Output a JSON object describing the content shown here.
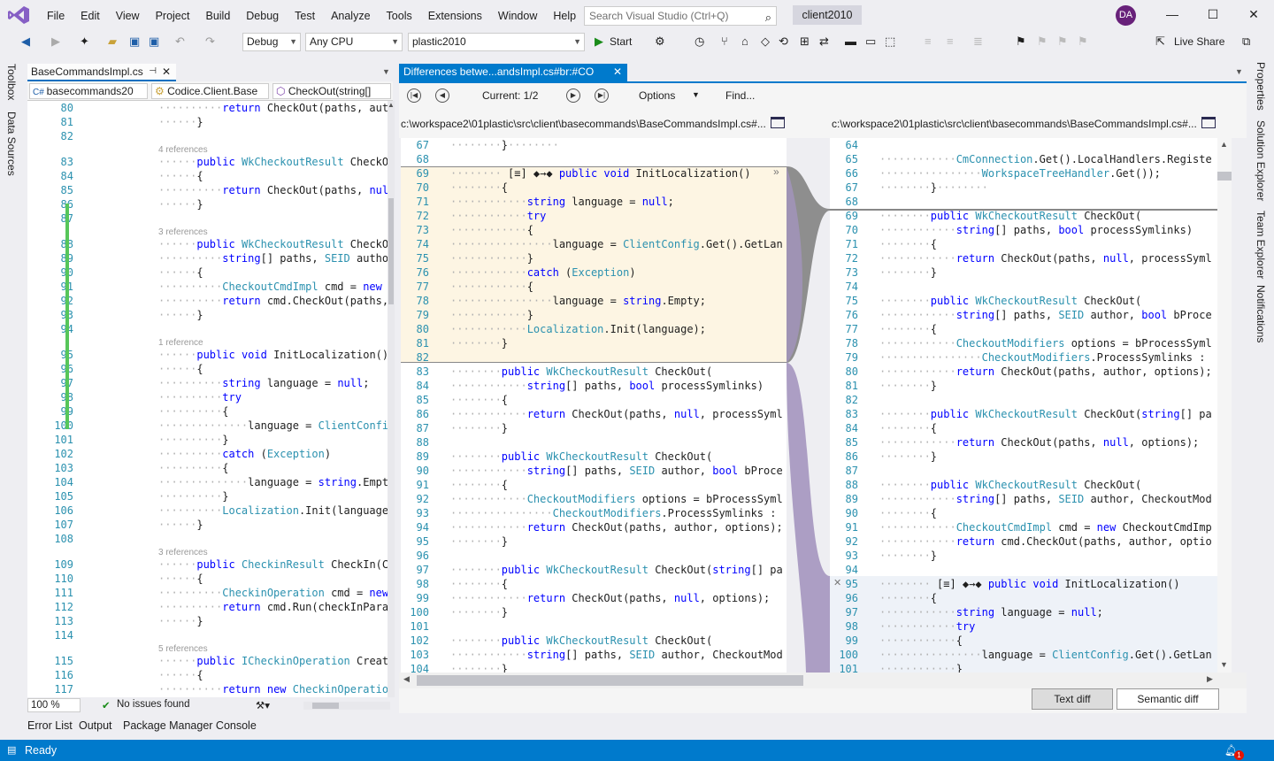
{
  "app": {
    "menu": [
      "File",
      "Edit",
      "View",
      "Project",
      "Build",
      "Debug",
      "Test",
      "Analyze",
      "Tools",
      "Extensions",
      "Window",
      "Help"
    ],
    "search_placeholder": "Search Visual Studio (Ctrl+Q)",
    "solution_name": "client2010",
    "avatar_initials": "DA",
    "accent_color": "#007acc"
  },
  "toolbar": {
    "config": "Debug",
    "platform": "Any CPU",
    "project": "plastic2010",
    "start_label": "Start",
    "live_share_label": "Live Share"
  },
  "left_tool_tabs": [
    "Toolbox",
    "Data Sources"
  ],
  "right_tool_tabs": [
    "Properties",
    "Solution Explorer",
    "Team Explorer",
    "Notifications"
  ],
  "left_editor": {
    "tab_title": "BaseCommandsImpl.cs",
    "nav_file": "basecommands20",
    "nav_class": "Codice.Client.Base",
    "nav_member": "CheckOut(string[]",
    "zoom": "100 %",
    "issues": "No issues found",
    "lines": [
      {
        "n": "80",
        "code": "··········return CheckOut(paths, author, "
      },
      {
        "n": "81",
        "code": "······}"
      },
      {
        "n": "82",
        "code": ""
      },
      {
        "refs": "4 references"
      },
      {
        "n": "83",
        "code": "······public WkCheckoutResult CheckOut(st"
      },
      {
        "n": "84",
        "code": "······{"
      },
      {
        "n": "85",
        "code": "··········return CheckOut(paths, null, op"
      },
      {
        "n": "86",
        "code": "······}"
      },
      {
        "n": "87",
        "code": ""
      },
      {
        "refs": "3 references"
      },
      {
        "n": "88",
        "code": "······public WkCheckoutResult CheckOut("
      },
      {
        "n": "89",
        "code": "··········string[] paths, SEID author, Ch"
      },
      {
        "n": "90",
        "code": "······{"
      },
      {
        "n": "91",
        "code": "··········CheckoutCmdImpl cmd = new Check"
      },
      {
        "n": "92",
        "code": "··········return cmd.CheckOut(paths, auth"
      },
      {
        "n": "93",
        "code": "······}"
      },
      {
        "n": "94",
        "code": ""
      },
      {
        "refs": "1 reference"
      },
      {
        "n": "95",
        "code": "······public void InitLocalization()"
      },
      {
        "n": "96",
        "code": "······{"
      },
      {
        "n": "97",
        "code": "··········string language = null;"
      },
      {
        "n": "98",
        "code": "··········try"
      },
      {
        "n": "99",
        "code": "··········{"
      },
      {
        "n": "100",
        "code": "··············language = ClientConfig.Get"
      },
      {
        "n": "101",
        "code": "··········}"
      },
      {
        "n": "102",
        "code": "··········catch (Exception)"
      },
      {
        "n": "103",
        "code": "··········{"
      },
      {
        "n": "104",
        "code": "··············language = string.Empty;"
      },
      {
        "n": "105",
        "code": "··········}"
      },
      {
        "n": "106",
        "code": "··········Localization.Init(language);"
      },
      {
        "n": "107",
        "code": "······}"
      },
      {
        "n": "108",
        "code": ""
      },
      {
        "refs": "3 references"
      },
      {
        "n": "109",
        "code": "······public CheckinResult CheckIn(Checki"
      },
      {
        "n": "110",
        "code": "······{"
      },
      {
        "n": "111",
        "code": "··········CheckinOperation cmd = new Chec"
      },
      {
        "n": "112",
        "code": "··········return cmd.Run(checkInParams);"
      },
      {
        "n": "113",
        "code": "······}"
      },
      {
        "n": "114",
        "code": ""
      },
      {
        "refs": "5 references"
      },
      {
        "n": "115",
        "code": "······public ICheckinOperation CreateChec"
      },
      {
        "n": "116",
        "code": "······{"
      },
      {
        "n": "117",
        "code": "··········return new CheckinOperation(thi"
      }
    ]
  },
  "diff": {
    "tab_title": "Differences betwe...andsImpl.cs#br:#CO",
    "current": "Current: 1/2",
    "options": "Options",
    "find": "Find...",
    "left_path": "c:\\workspace2\\01plastic\\src\\client\\basecommands\\BaseCommandsImpl.cs#...",
    "right_path": "c:\\workspace2\\01plastic\\src\\client\\basecommands\\BaseCommandsImpl.cs#...",
    "text_diff": "Text diff",
    "semantic_diff": "Semantic diff",
    "left_lines": [
      {
        "n": "67",
        "code": "········}········"
      },
      {
        "n": "68",
        "code": ""
      },
      {
        "n": "69",
        "code": "········ [≡] ◆→◆ public void InitLocalization()"
      },
      {
        "n": "70",
        "code": "········{"
      },
      {
        "n": "71",
        "code": "············string language = null;"
      },
      {
        "n": "72",
        "code": "············try"
      },
      {
        "n": "73",
        "code": "············{"
      },
      {
        "n": "74",
        "code": "················language = ClientConfig.Get().GetLan"
      },
      {
        "n": "75",
        "code": "············}"
      },
      {
        "n": "76",
        "code": "············catch (Exception)"
      },
      {
        "n": "77",
        "code": "············{"
      },
      {
        "n": "78",
        "code": "················language = string.Empty;"
      },
      {
        "n": "79",
        "code": "············}"
      },
      {
        "n": "80",
        "code": "············Localization.Init(language);"
      },
      {
        "n": "81",
        "code": "········}"
      },
      {
        "n": "82",
        "code": ""
      },
      {
        "n": "83",
        "code": "········public WkCheckoutResult CheckOut("
      },
      {
        "n": "84",
        "code": "············string[] paths, bool processSymlinks)"
      },
      {
        "n": "85",
        "code": "········{"
      },
      {
        "n": "86",
        "code": "············return CheckOut(paths, null, processSyml"
      },
      {
        "n": "87",
        "code": "········}"
      },
      {
        "n": "88",
        "code": ""
      },
      {
        "n": "89",
        "code": "········public WkCheckoutResult CheckOut("
      },
      {
        "n": "90",
        "code": "············string[] paths, SEID author, bool bProce"
      },
      {
        "n": "91",
        "code": "········{"
      },
      {
        "n": "92",
        "code": "············CheckoutModifiers options = bProcessSyml"
      },
      {
        "n": "93",
        "code": "················CheckoutModifiers.ProcessSymlinks :"
      },
      {
        "n": "94",
        "code": "············return CheckOut(paths, author, options);"
      },
      {
        "n": "95",
        "code": "········}"
      },
      {
        "n": "96",
        "code": ""
      },
      {
        "n": "97",
        "code": "········public WkCheckoutResult CheckOut(string[] pa"
      },
      {
        "n": "98",
        "code": "········{"
      },
      {
        "n": "99",
        "code": "············return CheckOut(paths, null, options);"
      },
      {
        "n": "100",
        "code": "········}"
      },
      {
        "n": "101",
        "code": ""
      },
      {
        "n": "102",
        "code": "········public WkCheckoutResult CheckOut("
      },
      {
        "n": "103",
        "code": "············string[] paths, SEID author, CheckoutMod"
      },
      {
        "n": "104",
        "code": "········}"
      }
    ],
    "right_lines": [
      {
        "n": "64",
        "code": ""
      },
      {
        "n": "65",
        "code": "············CmConnection.Get().LocalHandlers.Registe"
      },
      {
        "n": "66",
        "code": "················WorkspaceTreeHandler.Get());"
      },
      {
        "n": "67",
        "code": "········}········"
      },
      {
        "n": "68",
        "code": ""
      },
      {
        "n": "69",
        "code": "········public WkCheckoutResult CheckOut("
      },
      {
        "n": "70",
        "code": "············string[] paths, bool processSymlinks)"
      },
      {
        "n": "71",
        "code": "········{"
      },
      {
        "n": "72",
        "code": "············return CheckOut(paths, null, processSyml"
      },
      {
        "n": "73",
        "code": "········}"
      },
      {
        "n": "74",
        "code": ""
      },
      {
        "n": "75",
        "code": "········public WkCheckoutResult CheckOut("
      },
      {
        "n": "76",
        "code": "············string[] paths, SEID author, bool bProce"
      },
      {
        "n": "77",
        "code": "········{"
      },
      {
        "n": "78",
        "code": "············CheckoutModifiers options = bProcessSyml"
      },
      {
        "n": "79",
        "code": "················CheckoutModifiers.ProcessSymlinks :"
      },
      {
        "n": "80",
        "code": "············return CheckOut(paths, author, options);"
      },
      {
        "n": "81",
        "code": "········}"
      },
      {
        "n": "82",
        "code": ""
      },
      {
        "n": "83",
        "code": "········public WkCheckoutResult CheckOut(string[] pa"
      },
      {
        "n": "84",
        "code": "········{"
      },
      {
        "n": "85",
        "code": "············return CheckOut(paths, null, options);"
      },
      {
        "n": "86",
        "code": "········}"
      },
      {
        "n": "87",
        "code": ""
      },
      {
        "n": "88",
        "code": "········public WkCheckoutResult CheckOut("
      },
      {
        "n": "89",
        "code": "············string[] paths, SEID author, CheckoutMod"
      },
      {
        "n": "90",
        "code": "········{"
      },
      {
        "n": "91",
        "code": "············CheckoutCmdImpl cmd = new CheckoutCmdImp"
      },
      {
        "n": "92",
        "code": "············return cmd.CheckOut(paths, author, optio"
      },
      {
        "n": "93",
        "code": "········}"
      },
      {
        "n": "94",
        "code": ""
      },
      {
        "n": "95",
        "code": "········ [≡] ◆→◆ public void InitLocalization()"
      },
      {
        "n": "96",
        "code": "········{"
      },
      {
        "n": "97",
        "code": "············string language = null;"
      },
      {
        "n": "98",
        "code": "············try"
      },
      {
        "n": "99",
        "code": "············{"
      },
      {
        "n": "100",
        "code": "················language = ClientConfig.Get().GetLan"
      },
      {
        "n": "101",
        "code": "············}"
      }
    ]
  },
  "bottom_tabs": [
    "Error List",
    "Output",
    "Package Manager Console"
  ],
  "status": {
    "text": "Ready",
    "notifications": "1"
  }
}
